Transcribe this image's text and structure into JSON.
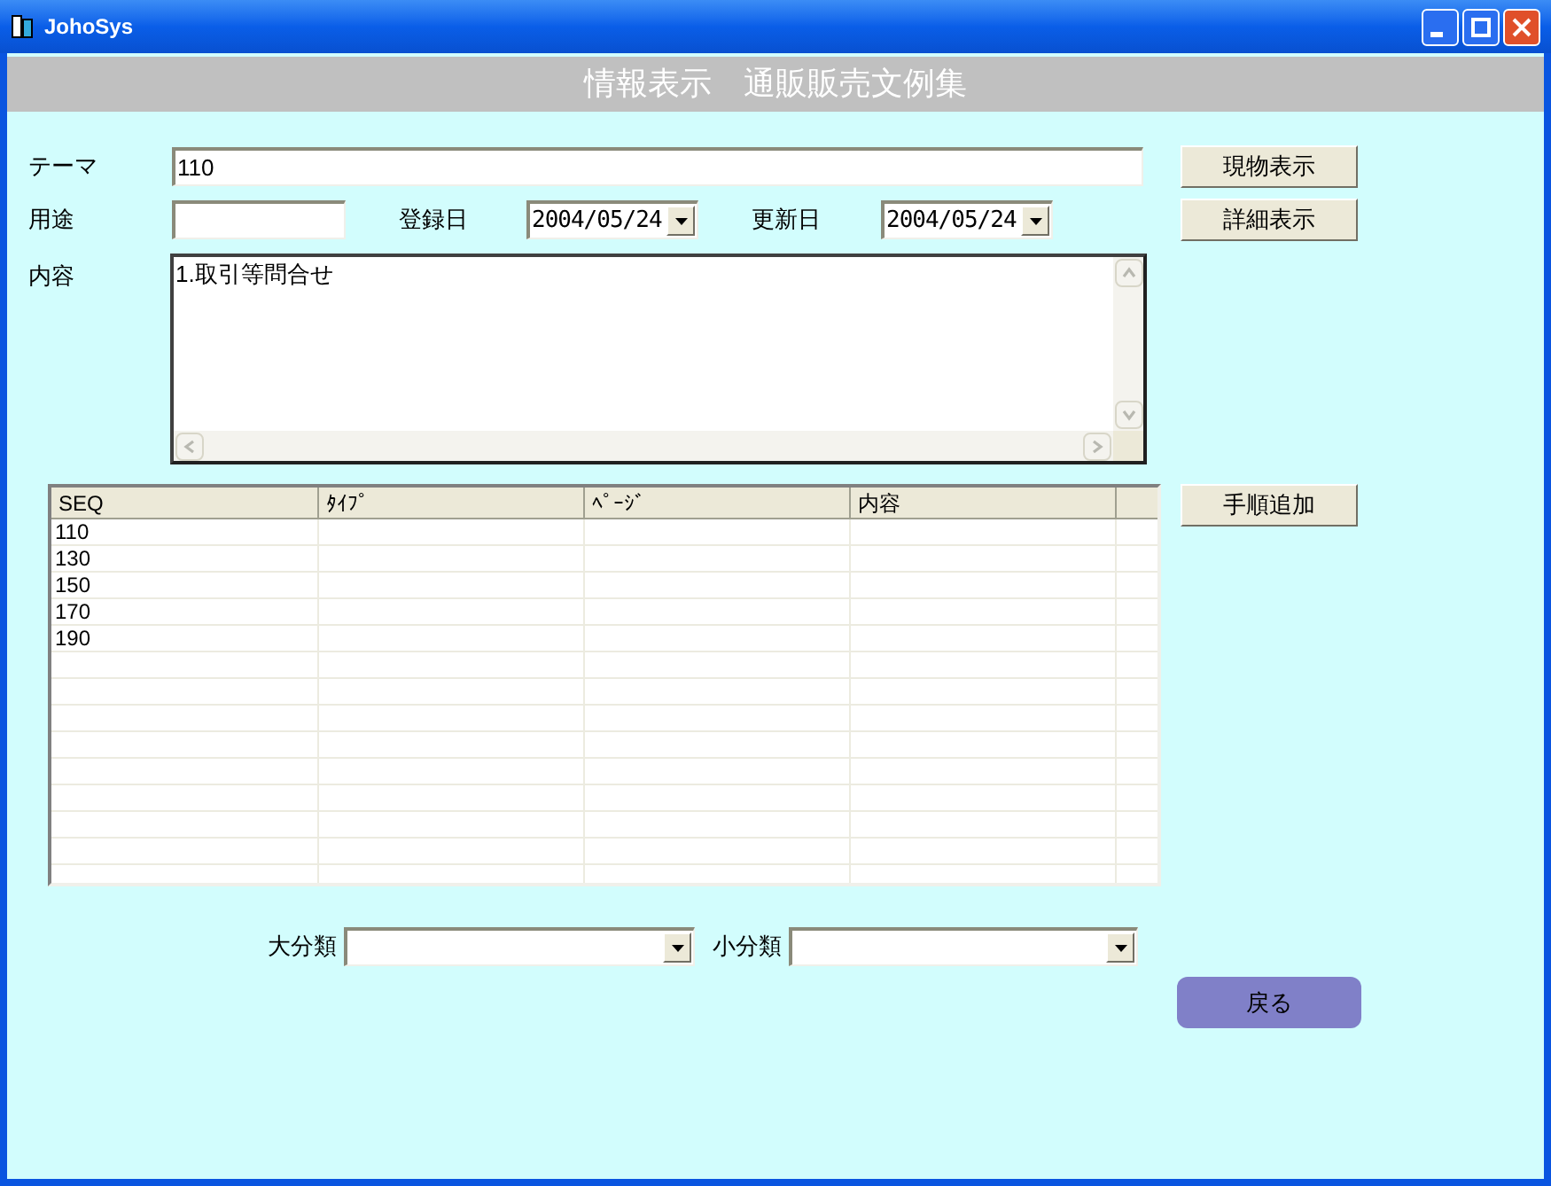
{
  "window": {
    "title": "JohoSys"
  },
  "header": {
    "title": "情報表示　通販販売文例集"
  },
  "theme": {
    "label": "テーマ",
    "value": "110"
  },
  "usage": {
    "label": "用途"
  },
  "registered": {
    "label": "登録日",
    "value": "2004/05/24"
  },
  "updated": {
    "label": "更新日",
    "value": "2004/05/24"
  },
  "content": {
    "label": "内容",
    "value": "1.取引等問合せ"
  },
  "actions": {
    "show_item": "現物表示",
    "show_detail": "詳細表示",
    "add_step": "手順追加",
    "back": "戻る"
  },
  "table": {
    "columns": [
      "SEQ",
      "ﾀｲﾌﾟ",
      "ﾍﾟｰｼﾞ",
      "内容"
    ],
    "rows": [
      {
        "seq": "110"
      },
      {
        "seq": "130"
      },
      {
        "seq": "150"
      },
      {
        "seq": "170"
      },
      {
        "seq": "190"
      }
    ]
  },
  "filters": [
    {
      "label": "大分類"
    },
    {
      "label": "小分類"
    }
  ]
}
